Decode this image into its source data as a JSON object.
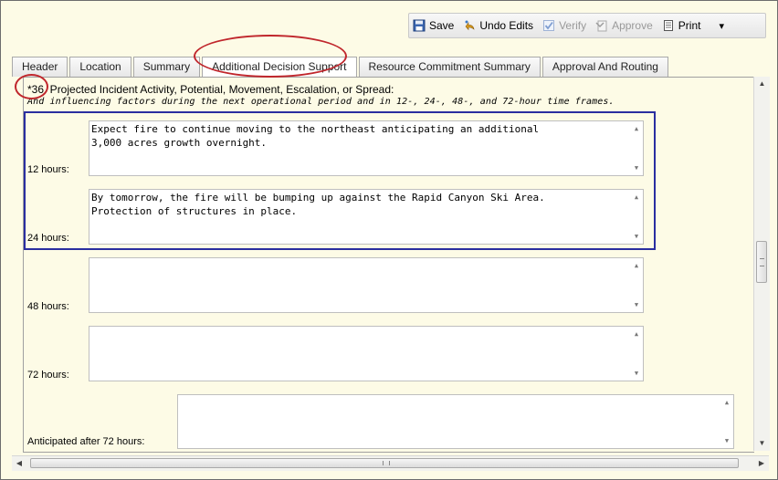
{
  "toolbar": {
    "save": "Save",
    "undo": "Undo Edits",
    "verify": "Verify",
    "approve": "Approve",
    "print": "Print",
    "more": "▾"
  },
  "tabs": [
    {
      "label": "Header"
    },
    {
      "label": "Location"
    },
    {
      "label": "Summary"
    },
    {
      "label": "Additional Decision Support"
    },
    {
      "label": "Resource Commitment Summary"
    },
    {
      "label": "Approval And Routing"
    }
  ],
  "question": {
    "label": "*36. Projected Incident Activity, Potential, Movement, Escalation, or Spread:",
    "sub": "And influencing factors during the next operational period and in 12-, 24-, 48-, and 72-hour time frames."
  },
  "rows": [
    {
      "label": "12 hours:",
      "value": "Expect fire to continue moving to the northeast anticipating an additional\n3,000 acres growth overnight."
    },
    {
      "label": "24 hours:",
      "value": "By tomorrow, the fire will be bumping up against the Rapid Canyon Ski Area.\nProtection of structures in place."
    },
    {
      "label": "48 hours:",
      "value": ""
    },
    {
      "label": "72 hours:",
      "value": ""
    },
    {
      "label": "Anticipated after 72 hours:",
      "value": ""
    }
  ],
  "colors": {
    "annotation_red": "#c0262c",
    "annotation_blue": "#2a2ea0",
    "background": "#fdfbe6"
  }
}
